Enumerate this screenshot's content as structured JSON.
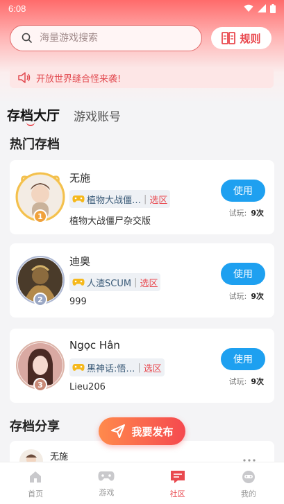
{
  "status": {
    "time": "6:08"
  },
  "search": {
    "placeholder": "海量游戏搜索"
  },
  "rules_label": "规则",
  "notice_text": "开放世界缝合怪来袭!",
  "tabs": {
    "active": "存档大厅",
    "inactive": "游戏账号"
  },
  "hot_title": "热门存档",
  "share_title": "存档分享",
  "cards": [
    {
      "name": "无施",
      "game": "植物大战僵…",
      "pick": "选区",
      "sub": "植物大战僵尸杂交版",
      "use": "使用",
      "tries_label": "试玩:",
      "tries": "9次",
      "rank": "1",
      "rank_color": "#f0a23c"
    },
    {
      "name": "迪奥",
      "game": "人渣SCUM",
      "pick": "选区",
      "sub": "999",
      "use": "使用",
      "tries_label": "试玩:",
      "tries": "9次",
      "rank": "2",
      "rank_color": "#9aa7c4"
    },
    {
      "name": "Ngọc Hân",
      "game": "黑神话:悟…",
      "pick": "选区",
      "sub": "Lieu206",
      "use": "使用",
      "tries_label": "试玩:",
      "tries": "9次",
      "rank": "3",
      "rank_color": "#c98a78"
    }
  ],
  "share_preview": {
    "name": "无施"
  },
  "publish_label": "我要发布",
  "nav": [
    {
      "label": "首页",
      "icon": "home-icon"
    },
    {
      "label": "游戏",
      "icon": "gamepad-icon"
    },
    {
      "label": "社区",
      "icon": "community-icon"
    },
    {
      "label": "我的",
      "icon": "profile-icon"
    }
  ],
  "colors": {
    "accent": "#e9494f",
    "use_button": "#1ea0f0"
  }
}
